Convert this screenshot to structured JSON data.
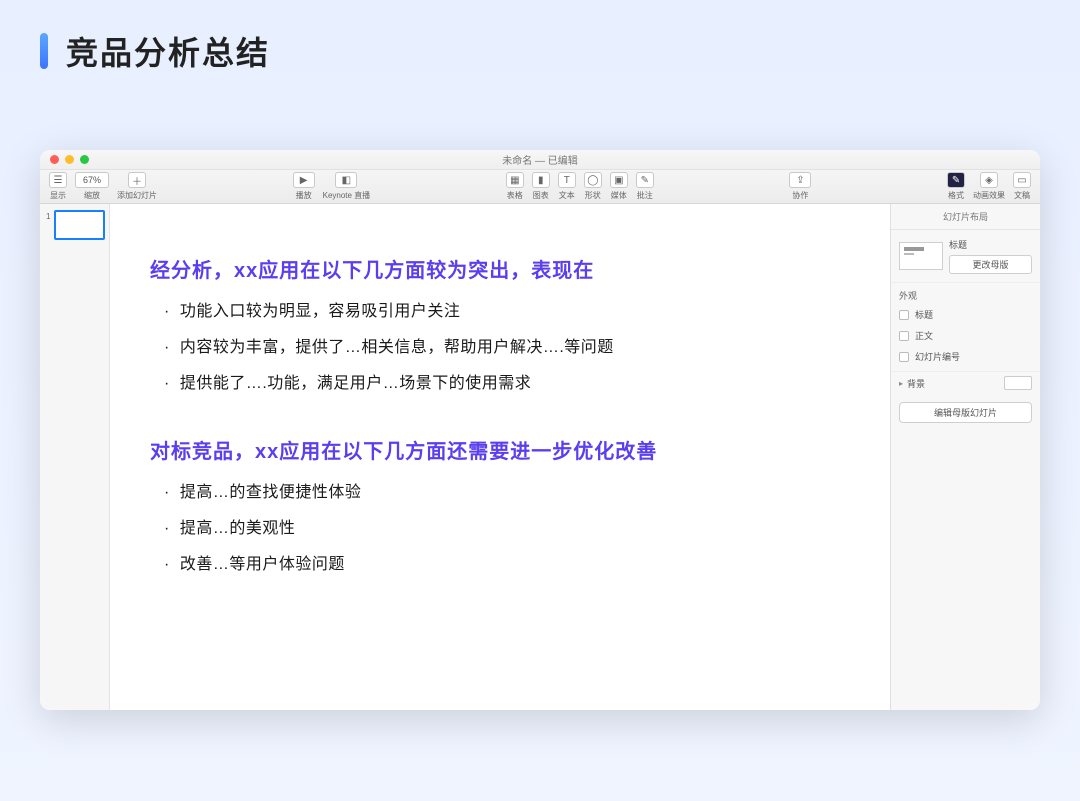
{
  "page": {
    "title": "竞品分析总结"
  },
  "window": {
    "title": "未命名 — 已编辑"
  },
  "toolbar": {
    "view": "显示",
    "zoom_value": "67%",
    "zoom_label": "缩放",
    "add_slide": "添加幻灯片",
    "play": "播放",
    "keynote_live": "Keynote 直播",
    "table": "表格",
    "chart": "图表",
    "text": "文本",
    "shape": "形状",
    "media": "媒体",
    "comment": "批注",
    "collab": "协作",
    "format": "格式",
    "animate": "动画效果",
    "document": "文稿"
  },
  "thumbs": {
    "first_index": "1"
  },
  "slide": {
    "heading1": "经分析，xx应用在以下几方面较为突出，表现在",
    "items1": [
      "功能入口较为明显，容易吸引用户关注",
      "内容较为丰富，提供了…相关信息，帮助用户解决….等问题",
      "提供能了….功能，满足用户…场景下的使用需求"
    ],
    "heading2": "对标竞品，xx应用在以下几方面还需要进一步优化改善",
    "items2": [
      "提高…的查找便捷性体验",
      "提高…的美观性",
      "改善…等用户体验问题"
    ]
  },
  "inspector": {
    "tab_format": "格式",
    "tab_animate": "动画效果",
    "tab_document": "文稿",
    "section_layout": "幻灯片布局",
    "layout_name": "标题",
    "change_master": "更改母版",
    "appearance": "外观",
    "chk_title": "标题",
    "chk_body": "正文",
    "chk_slidenum": "幻灯片编号",
    "background": "背景",
    "edit_master": "编辑母版幻灯片"
  }
}
